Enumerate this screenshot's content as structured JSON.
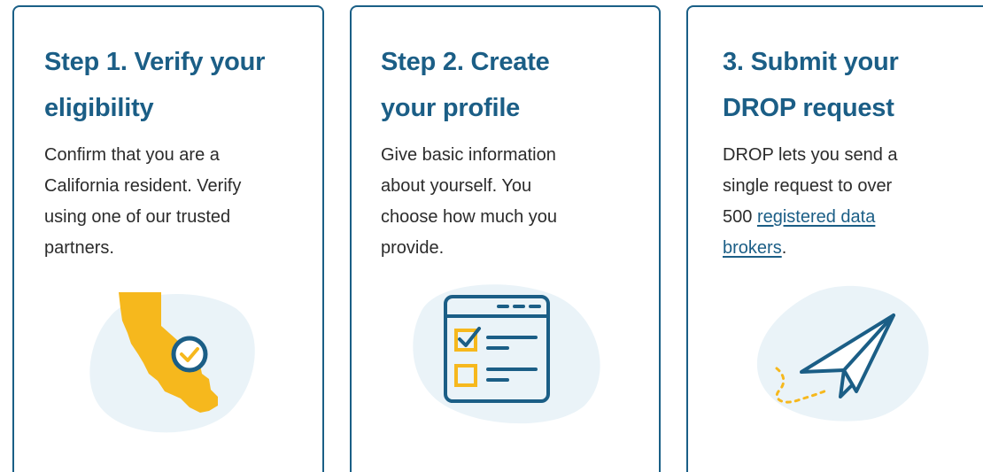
{
  "cards": [
    {
      "title_lines": [
        "Step 1. Verify your",
        "eligibility"
      ],
      "body_lines": [
        "Confirm that you are a",
        "California resident. Verify",
        "using one of our trusted",
        "partners."
      ],
      "illustration": "california-map-check-icon"
    },
    {
      "title_lines": [
        "Step 2. Create",
        "your profile"
      ],
      "body_lines": [
        "Give basic information",
        "about yourself. You",
        "choose how much you",
        "provide."
      ],
      "illustration": "profile-form-checklist-icon"
    },
    {
      "title_lines": [
        "3. Submit your",
        "DROP request"
      ],
      "body_lines": [
        "DROP lets you send a",
        "single request to over"
      ],
      "body_line_3_prefix": "500 ",
      "link_part_1": "registered data",
      "link_part_2": "brokers",
      "body_suffix": ".",
      "illustration": "paper-plane-icon"
    }
  ],
  "colors": {
    "brand_blue": "#1b5e86",
    "accent_yellow": "#f6b81d",
    "blob_bg": "#eaf3f8",
    "body_text": "#2b2b2b"
  }
}
